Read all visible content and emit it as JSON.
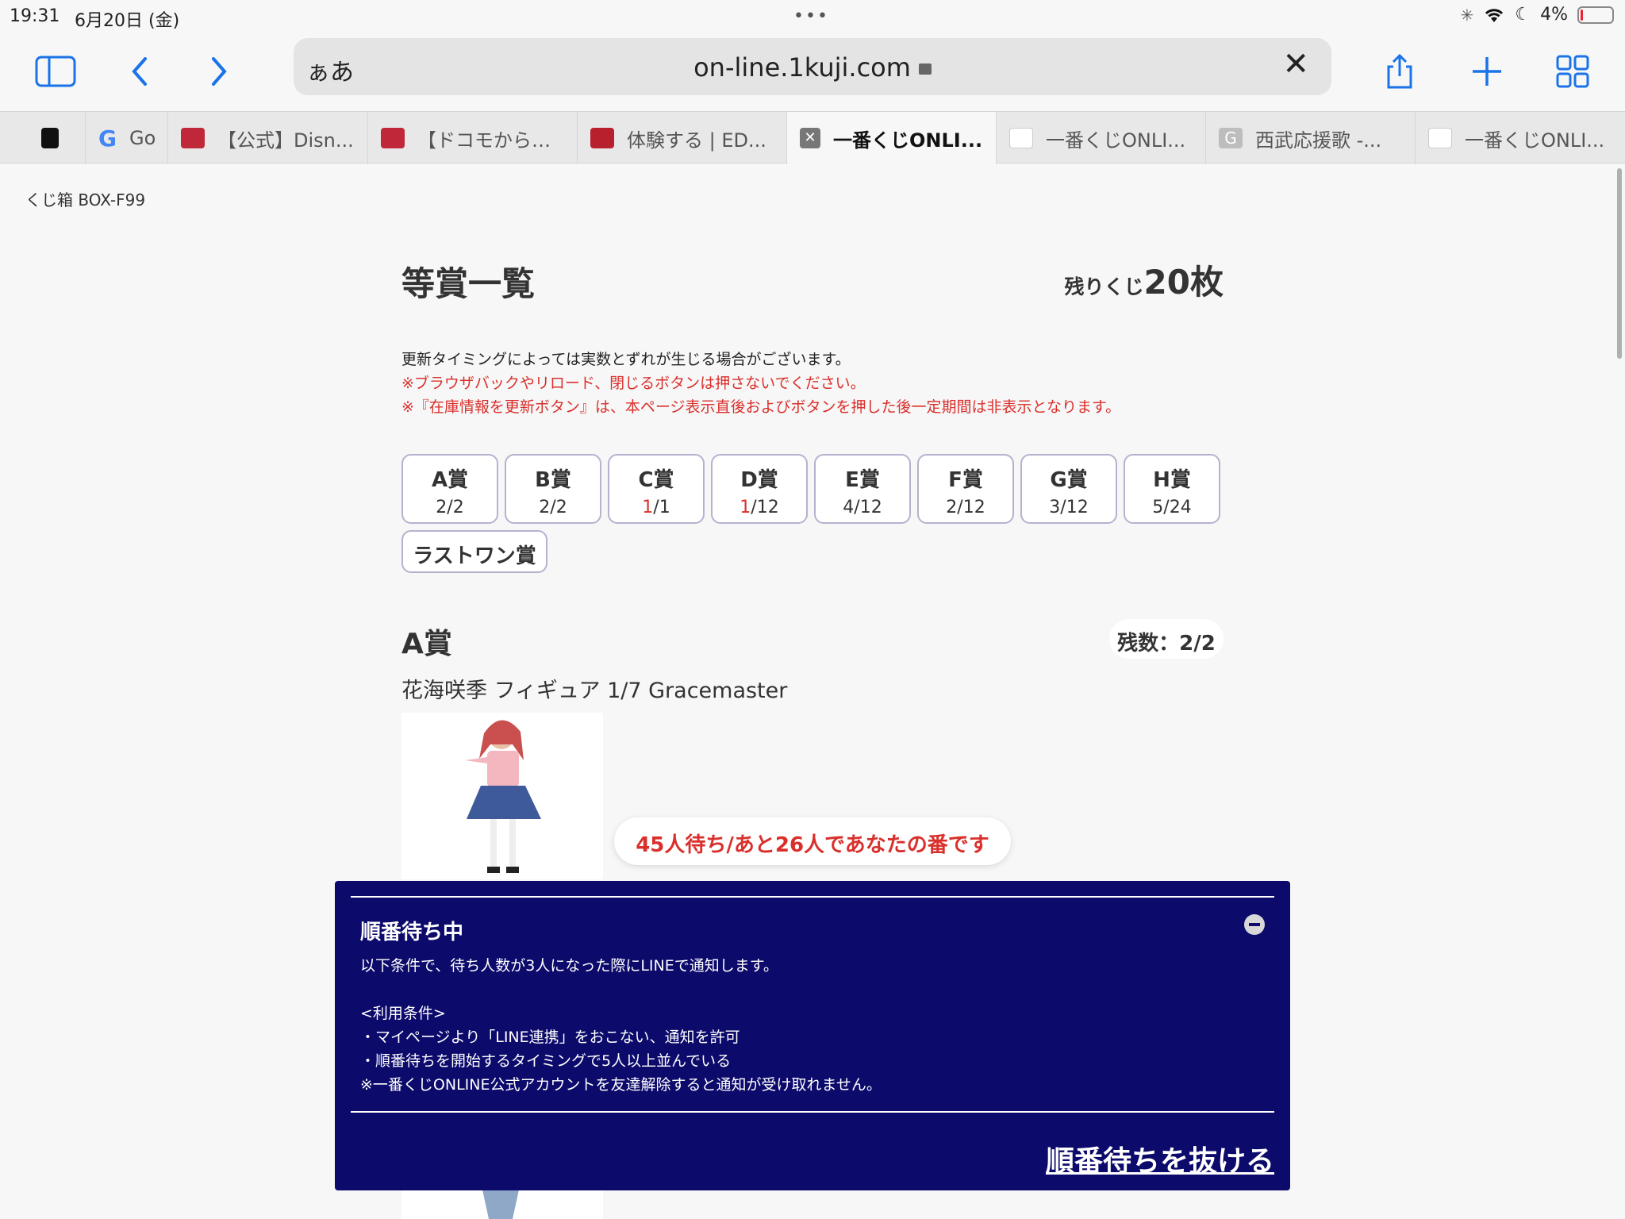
{
  "status": {
    "time": "19:31",
    "date": "6月20日 (金)",
    "battery": "4%"
  },
  "browser": {
    "aa": "ぁあ",
    "url": "on-line.1kuji.com",
    "tabs": [
      {
        "label": "",
        "favicon_color": "#111111"
      },
      {
        "label": "Go",
        "favicon_color": "#ffffff"
      },
      {
        "label": "【公式】Disn...",
        "favicon_color": "#c0283a"
      },
      {
        "label": "【ドコモから…",
        "favicon_color": "#c0283a"
      },
      {
        "label": "体験する | ED...",
        "favicon_color": "#b8202e"
      },
      {
        "label": "一番くじONLI...",
        "favicon_color": "#777777",
        "active": true
      },
      {
        "label": "一番くじONLI...",
        "favicon_color": "#ffffff"
      },
      {
        "label": "西武応援歌 -...",
        "favicon_color": "#bdbdbd"
      },
      {
        "label": "一番くじONLI...",
        "favicon_color": "#ffffff"
      }
    ]
  },
  "page": {
    "back": "くじ箱 BOX-F99",
    "title": "等賞一覧",
    "remain_prefix": "残りくじ",
    "remain_count": "20枚",
    "notes": [
      "更新タイミングによっては実数とずれが生じる場合がございます。",
      "※ブラウザバックやリロード、閉じるボタンは押さないでください。",
      "※『在庫情報を更新ボタン』は、本ページ表示直後およびボタンを押した後一定期間は非表示となります。"
    ],
    "prizes": [
      {
        "name": "A賞",
        "left": "2",
        "total": "/2",
        "red": false
      },
      {
        "name": "B賞",
        "left": "2",
        "total": "/2",
        "red": false
      },
      {
        "name": "C賞",
        "left": "1",
        "total": "/1",
        "red": true
      },
      {
        "name": "D賞",
        "left": "1",
        "total": "/12",
        "red": true
      },
      {
        "name": "E賞",
        "left": "4",
        "total": "/12",
        "red": false
      },
      {
        "name": "F賞",
        "left": "2",
        "total": "/12",
        "red": false
      },
      {
        "name": "G賞",
        "left": "3",
        "total": "/12",
        "red": false
      },
      {
        "name": "H賞",
        "left": "5",
        "total": "/24",
        "red": false
      }
    ],
    "last_one": "ラストワン賞",
    "section": {
      "title": "A賞",
      "stock": "残数：2/2",
      "product": "花海咲季 フィギュア 1/7 Gracemaster"
    },
    "wait_banner": "45人待ち/あと26人であなたの番です"
  },
  "queue_panel": {
    "title": "順番待ち中",
    "lines": [
      "以下条件で、待ち人数が3人になった際にLINEで通知します。",
      "",
      "<利用条件>",
      "・マイページより「LINE連携」をおこない、通知を許可",
      "・順番待ちを開始するタイミングで5人以上並んでいる",
      "※一番くじONLINE公式アカウントを友達解除すると通知が受け取れません。"
    ],
    "leave": "順番待ちを抜ける"
  }
}
